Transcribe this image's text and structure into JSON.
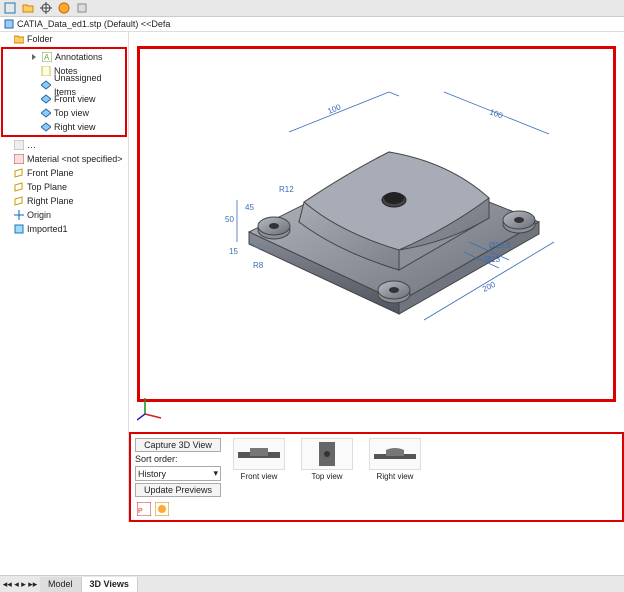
{
  "file": {
    "name": "CATIA_Data_ed1.stp (Default) <<Defa"
  },
  "tree": {
    "folder": "Folder",
    "annotations_root": "Annotations",
    "annotations": [
      "Notes",
      "Unassigned Items",
      "Front view",
      "Top view",
      "Right view"
    ],
    "items": [
      "Material <not specified>",
      "Front Plane",
      "Top Plane",
      "Right Plane",
      "Origin",
      "Imported1"
    ]
  },
  "dimensions": {
    "a": "100",
    "b": "100",
    "c": "200",
    "d": "50",
    "e": "45",
    "f": "R12",
    "g": "15",
    "h": "R8",
    "i": "Ø19.5",
    "j": "Ø13"
  },
  "panel": {
    "capture": "Capture 3D View",
    "sort_label": "Sort order:",
    "sort_value": "History",
    "update": "Update Previews",
    "views": [
      "Front view",
      "Top view",
      "Right view"
    ]
  },
  "tabs": {
    "model": "Model",
    "views3d": "3D Views"
  }
}
